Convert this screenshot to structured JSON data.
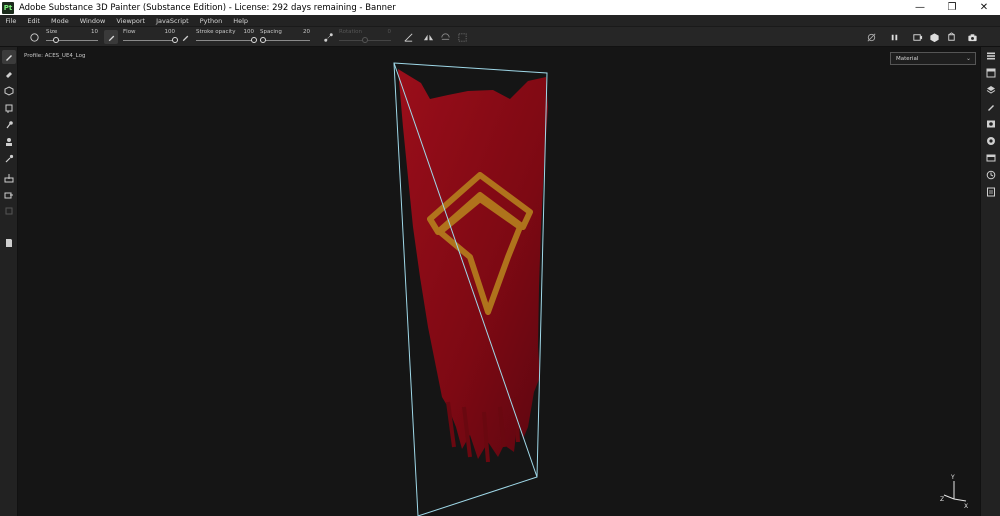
{
  "window": {
    "title": "Adobe Substance 3D Painter (Substance Edition) - License: 292 days remaining - Banner",
    "app_icon_text": "Pt",
    "controls": {
      "minimize": "—",
      "restore": "❐",
      "close": "✕"
    }
  },
  "menu": [
    "File",
    "Edit",
    "Mode",
    "Window",
    "Viewport",
    "JavaScript",
    "Python",
    "Help"
  ],
  "toolbar": {
    "size": {
      "label": "Size",
      "value": "10",
      "fraction": 0.2
    },
    "flow": {
      "label": "Flow",
      "value": "100",
      "fraction": 1.0
    },
    "stroke_opacity": {
      "label": "Stroke opacity",
      "value": "100",
      "fraction": 1.0
    },
    "spacing": {
      "label": "Spacing",
      "value": "20",
      "fraction": 0.05
    },
    "rotation": {
      "label": "Rotation",
      "value": "0",
      "fraction": 0.5,
      "disabled": true
    }
  },
  "viewport": {
    "profile": "Profile: ACES_UE4_Log",
    "display_mode": "Material",
    "gizmo": {
      "x": "X",
      "y": "Y",
      "z": "Z"
    }
  },
  "colors": {
    "banner_red": "#8c0a14",
    "emblem_gold": "#b8861e",
    "wireframe": "#9fd8e8",
    "background": "#151515"
  },
  "icons": {
    "left_tools": [
      "brush-icon",
      "eraser-icon",
      "projection-icon",
      "geometry-mask-icon",
      "smudge-icon",
      "clone-icon",
      "color-picker-icon",
      "bake-icon",
      "export-icon",
      "undo-icon",
      "document-icon"
    ],
    "right_panels": [
      "layers-stack-icon",
      "texture-set-icon",
      "layers-icon",
      "properties-icon",
      "display-settings-icon",
      "viewer-icon",
      "shelf-icon",
      "history-icon",
      "log-icon"
    ]
  }
}
